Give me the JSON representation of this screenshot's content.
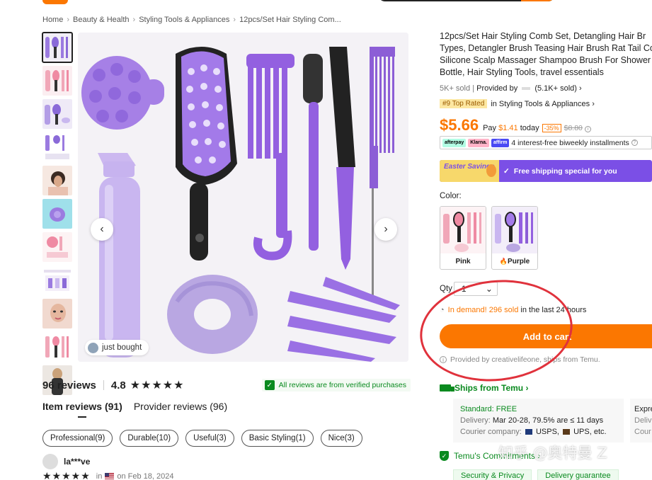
{
  "breadcrumb": [
    "Home",
    "Beauty & Health",
    "Styling Tools & Appliances",
    "12pcs/Set Hair Styling Com..."
  ],
  "gallery": {
    "just_bought": "just bought",
    "prev_icon": "chevron-left-icon",
    "next_icon": "chevron-right-icon"
  },
  "reviews": {
    "count_label": "96 reviews",
    "rating": "4.8",
    "stars": "★★★★★",
    "verified": "All reviews are from verified purchases",
    "tabs": [
      "Item reviews (91)",
      "Provider reviews (96)"
    ],
    "tags": [
      "Professional(9)",
      "Durable(10)",
      "Useful(3)",
      "Basic Styling(1)",
      "Nice(3)"
    ],
    "first_reviewer": "la***ve",
    "first_stars": "★★★★★",
    "first_in": "in",
    "first_date": "on Feb 18, 2024"
  },
  "product": {
    "title_lines": [
      "12pcs/Set Hair Styling Comb Set, Detangling Hair Br",
      "Types, Detangler Brush Teasing Hair Brush Rat Tail Co",
      "Silicone Scalp Massager Shampoo Brush For Shower",
      "Bottle, Hair Styling Tools, travel essentials"
    ],
    "sold": "5K+ sold",
    "provided_by": "Provided by",
    "provider_sold": "(5.1K+ sold)",
    "rank_badge": "#9 Top Rated",
    "rank_category": "in Styling Tools & Appliances",
    "price": "$5.66",
    "pay_prefix": "Pay",
    "pay_amount": "$1.41",
    "pay_suffix": "today",
    "discount": "-35%",
    "old_price": "$8.80",
    "installments": "4 interest-free biweekly installments",
    "pay_methods": [
      "afterpay",
      "Klarna.",
      "affirm"
    ],
    "promo_easter": "Easter Savings",
    "promo_text": "Free shipping special for you",
    "color_label": "Color:",
    "colors": [
      "Pink",
      "Purple"
    ],
    "qty_label": "Qty",
    "qty_value": "1",
    "demand_prefix": "In demand!",
    "demand_sold": "296 sold",
    "demand_suffix": "in the last 24 hours",
    "add_to_cart": "Add to cart",
    "provided_note": "Provided by creativelifeone, ships from Temu."
  },
  "shipping": {
    "ships_from": "Ships from Temu",
    "standard": "Standard: FREE",
    "delivery_label": "Delivery:",
    "delivery_value": "Mar 20-28, 79.5% are ≤ 11 days",
    "courier_label": "Courier company:",
    "couriers": [
      "USPS,",
      "UPS, etc."
    ],
    "express_lines": [
      "Expre",
      "Deliv",
      "Cour"
    ],
    "commitments": "Temu's Commitments",
    "chips": [
      "Security & Privacy",
      "Delivery guarantee"
    ]
  },
  "watermark": "知乎 @奥特曼 Z",
  "colors": {
    "accent": "#fb7701",
    "green": "#0a8a1f",
    "promo": "#7b4fe6",
    "annotation": "#e0323c"
  }
}
